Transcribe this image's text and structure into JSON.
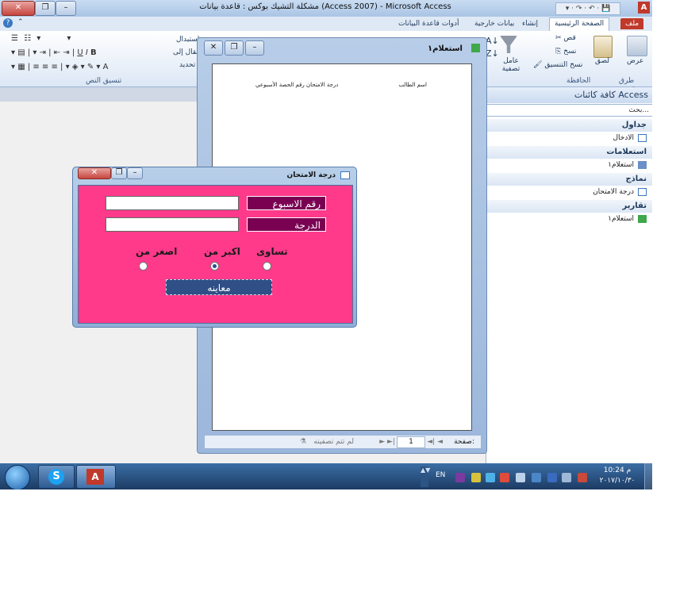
{
  "window": {
    "title": "مشكلة التشيك بوكس : قاعدة بيانات (Access 2007) - Microsoft Access"
  },
  "ribbon": {
    "tabs": [
      "ملف",
      "الصفحة الرئيسية",
      "إنشاء",
      "بيانات خارجية",
      "أدوات قاعدة البيانات"
    ],
    "active_tab": "الصفحة الرئيسية",
    "clipboard_group": {
      "label": "الحافظة",
      "cut": "قص",
      "copy": "نسخ",
      "format_painter": "نسخ التنسيق",
      "paste": "لصق"
    },
    "views_group": {
      "label": "طرق عرض",
      "view": "عرض"
    },
    "filter_group": {
      "filter": "عامل تصفية"
    },
    "text_format_group": {
      "label": "تنسيق النص"
    },
    "partial_labels": [
      "استبدال",
      "انتقال إلى",
      "تحديد"
    ]
  },
  "nav_pane": {
    "header": "كافة كائنات Access",
    "search_placeholder": "بحث...",
    "sections": [
      {
        "title": "جداول",
        "items": [
          "الادخال"
        ]
      },
      {
        "title": "استعلامات",
        "items": [
          "استعلام١"
        ]
      },
      {
        "title": "نماذج",
        "items": [
          "درجة الامتحان"
        ]
      },
      {
        "title": "تقارير",
        "items": [
          "استعلام١"
        ]
      }
    ]
  },
  "report_window": {
    "title": "استعلام١",
    "columns": [
      "اسم الطالب",
      "درجة الامتحان رقم الحصة الأسبوعي"
    ],
    "navigation": {
      "page_label": "صفحة:",
      "page_value": "1",
      "filter_status": "لم تتم تصفيته"
    }
  },
  "form_window": {
    "title": "درجة الامتحان",
    "fields": [
      {
        "label": "رقم الاسبوع",
        "value": ""
      },
      {
        "label": "الدرجة",
        "value": ""
      }
    ],
    "options": [
      {
        "label": "تساوى",
        "selected": false
      },
      {
        "label": "اكبر من",
        "selected": true
      },
      {
        "label": "اصغر من",
        "selected": false
      }
    ],
    "preview_button": "معاينه",
    "background_color": "#ff3a8a",
    "label_color": "#7a0052"
  },
  "taskbar": {
    "language": "EN",
    "time": "10:24 م",
    "date": "٢٠١٧/١٠/٣٠"
  }
}
